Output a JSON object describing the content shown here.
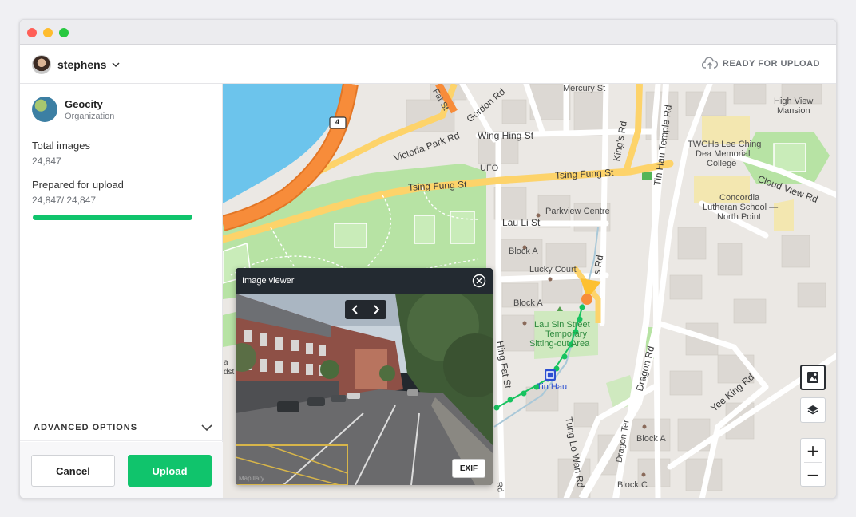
{
  "header": {
    "username": "stephens",
    "status": "READY FOR UPLOAD"
  },
  "sidebar": {
    "org_name": "Geocity",
    "org_type": "Organization",
    "total_images_label": "Total images",
    "total_images_value": "24,847",
    "prepared_label": "Prepared for upload",
    "prepared_value": "24,847/ 24,847",
    "prepared_progress": 1.0,
    "advanced_options": "ADVANCED OPTIONS",
    "cancel_label": "Cancel",
    "upload_label": "Upload"
  },
  "viewer": {
    "title": "Image viewer",
    "exif_label": "EXIF",
    "watermark": "Mapillary"
  },
  "map": {
    "labels": {
      "mercury": "Mercury St",
      "gordon": "Gordon Rd",
      "fat_st": "Fat St",
      "wing_hing": "Wing Hing St",
      "victoria_park": "Victoria Park Rd",
      "tsing_fung_1": "Tsing Fung St",
      "tsing_fung_2": "Tsing Fung St",
      "kings_rd": "King's Rd",
      "tin_hau_temple": "Tin Hau Temple Rd",
      "high_view": "High View",
      "mansion": "Mansion",
      "twghs1": "TWGHs Lee Ching",
      "twghs2": "Dea Memorial",
      "twghs3": "College",
      "cloud_view": "Cloud View Rd",
      "concordia1": "Concordia",
      "concordia2": "Lutheran School —",
      "concordia3": "North Point",
      "ufo": "UFO",
      "lau_li": "Lau Li St",
      "parkview": "Parkview Centre",
      "block_a1": "Block A",
      "lucky_court": "Lucky Court",
      "block_a2": "Block A",
      "s_rd": "s Rd",
      "lau_sin1": "Lau Sin Street",
      "lau_sin2": "Temporary",
      "lau_sin3": "Sitting-out Area",
      "hing_fat": "Hing Fat St",
      "tin_hau": "Tin Hau",
      "dragon_rd": "Dragon Rd",
      "yee_king": "Yee King Rd",
      "tung_lo_wan": "Tung Lo Wan Rd",
      "dragon_ter": "Dragon Ter",
      "block_a3": "Block A",
      "block_c": "Block C",
      "road_num": "4",
      "rd_label": "Rd",
      "edge_a": "a",
      "edge_dst": "dst"
    },
    "zoom_in": "+",
    "zoom_out": "−"
  },
  "colors": {
    "accent": "#10c46c",
    "water": "#6cc4ec",
    "park": "#b7e3a4",
    "highway": "#f78c3a",
    "trace": "#17c35f"
  }
}
